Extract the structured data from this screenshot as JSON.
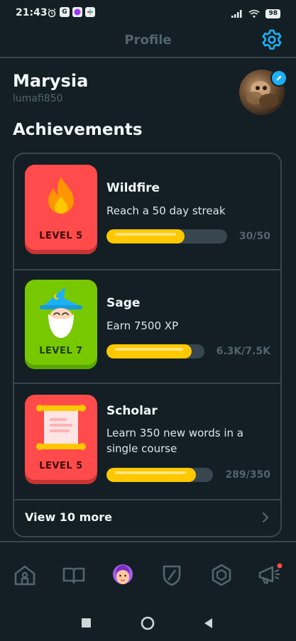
{
  "status_bar": {
    "time": "21:43",
    "battery": "98",
    "icons": [
      "alarm-icon",
      "google-icon",
      "messenger-icon",
      "slack-icon",
      "signal-icon",
      "wifi-icon",
      "battery-icon"
    ]
  },
  "header": {
    "title": "Profile",
    "settings_icon": "gear-icon"
  },
  "profile": {
    "name": "Marysia",
    "username": "lumafi850",
    "avatar_edit_icon": "pencil-icon"
  },
  "achievements": {
    "section_title": "Achievements",
    "items": [
      {
        "title": "Wildfire",
        "description": "Reach a 50 day streak",
        "level": "LEVEL 5",
        "progress_text": "30/50",
        "progress": 0.6,
        "badge_color": "#ff4b4b",
        "icon": "flame-icon"
      },
      {
        "title": "Sage",
        "description": "Earn 7500 XP",
        "level": "LEVEL 7",
        "progress_text": "6.3K/7.5K",
        "progress": 0.84,
        "badge_color": "#78c800",
        "icon": "wizard-icon"
      },
      {
        "title": "Scholar",
        "description": "Learn 350 new words in a single course",
        "level": "LEVEL 5",
        "progress_text": "289/350",
        "progress": 0.83,
        "badge_color": "#ff4b4b",
        "icon": "scroll-icon"
      }
    ],
    "view_more": "View 10 more"
  },
  "bottom_nav": {
    "items": [
      "home-icon",
      "book-icon",
      "profile-icon",
      "shield-icon",
      "hexagon-icon",
      "megaphone-icon"
    ],
    "active": "profile-icon"
  },
  "colors": {
    "background": "#131f24",
    "border": "#37464f",
    "accent": "#1cb0f6",
    "progress": "#ffc800",
    "muted": "#52656d"
  }
}
